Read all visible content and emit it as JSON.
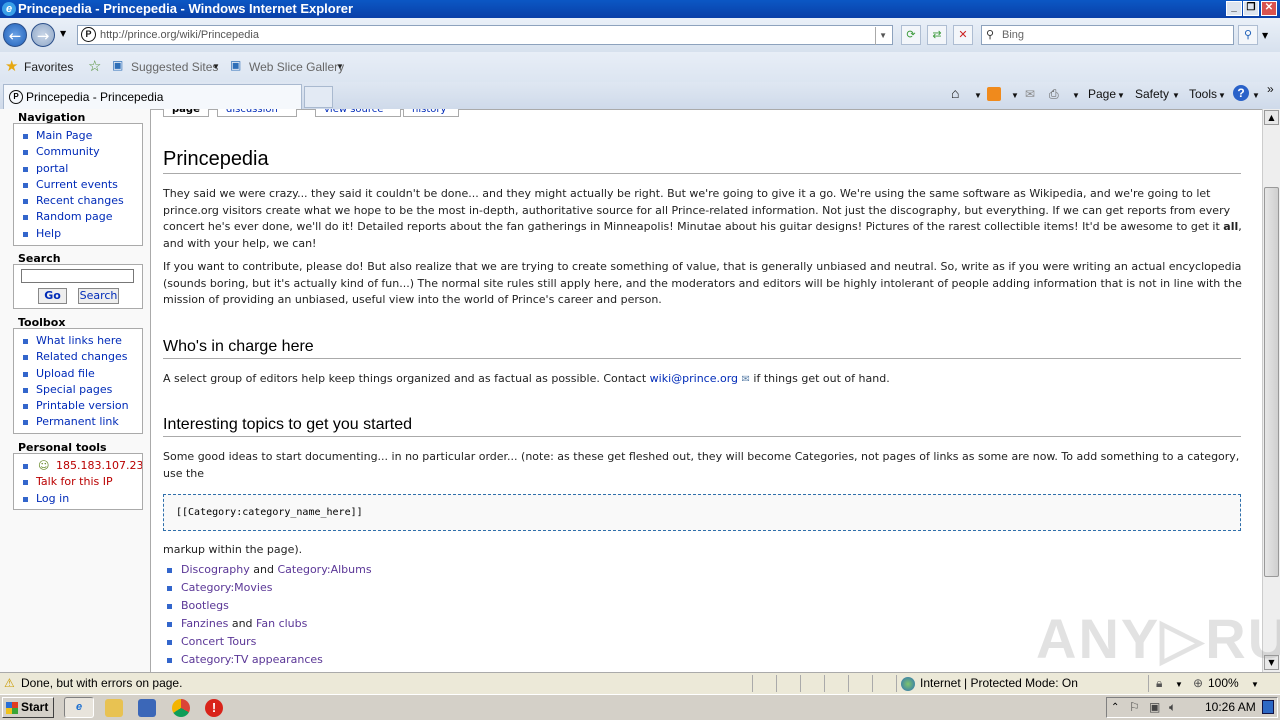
{
  "window": {
    "title": "Princepedia - Princepedia - Windows Internet Explorer"
  },
  "address": {
    "url": "http://prince.org/wiki/Princepedia",
    "search_placeholder": "Bing"
  },
  "favorites": {
    "favorites_label": "Favorites",
    "suggested_label": "Suggested Sites",
    "gallery_label": "Web Slice Gallery"
  },
  "tab": {
    "label": "Princepedia - Princepedia"
  },
  "commandbar": {
    "page": "Page",
    "safety": "Safety",
    "tools": "Tools"
  },
  "wiki_tabs": [
    "page",
    "discussion",
    "view source",
    "history"
  ],
  "sidebar": {
    "navigation_title": "Navigation",
    "navigation": [
      "Main Page",
      "Community",
      "portal",
      "Current events",
      "Recent changes",
      "Random page",
      "Help"
    ],
    "search_title": "Search",
    "go_label": "Go",
    "search_label": "Search",
    "toolbox_title": "Toolbox",
    "toolbox": [
      "What links here",
      "Related changes",
      "Upload file",
      "Special pages",
      "Printable version",
      "Permanent link"
    ],
    "personal_title": "Personal tools",
    "personal": [
      "185.183.107.23",
      "Talk for this IP",
      "Log in"
    ]
  },
  "article": {
    "title": "Princepedia",
    "intro_before_bold": "They said we were crazy... they said it couldn't be done... and they might actually be right. But we're going to give it a go. We're using the same software as Wikipedia, and we're going to let prince.org visitors create what we hope to be the most in-depth, authoritative source for all Prince-related information. Not just the discography, but everything. If we can get reports from every concert he's ever done, we'll do it! Detailed reports about the fan gatherings in Minneapolis! Minutae about his guitar designs! Pictures of the rarest collectible items! It'd be awesome to get it ",
    "intro_bold": "all",
    "intro_after_bold": ", and with your help, we can!",
    "contribute": "If you want to contribute, please do! But also realize that we are trying to create something of value, that is generally unbiased and neutral. So, write as if you were writing an actual encyclopedia (sounds boring, but it's actually kind of fun...) The normal site rules still apply here, and the moderators and editors will be highly intolerant of people adding information that is not in line with the mission of providing an unbiased, useful view into the world of Prince's career and person.",
    "charge_heading": "Who's in charge here",
    "charge_before": "A select group of editors help keep things organized and as factual as possible. Contact ",
    "charge_email": "wiki@prince.org",
    "charge_after": " if things get out of hand.",
    "topics_heading": "Interesting topics to get you started",
    "topics_intro": "Some good ideas to start documenting... in no particular order... (note: as these get fleshed out, they will become Categories, not pages of links as some are now. To add something to a category, use the",
    "code": "[[Category:category_name_here]]",
    "markup_note": "markup within the page).",
    "topics": [
      {
        "a": "Discography",
        "mid": " and ",
        "b": "Category:Albums"
      },
      {
        "a": "Category:Movies",
        "mid": "",
        "b": ""
      },
      {
        "a": "Bootlegs",
        "mid": "",
        "b": ""
      },
      {
        "a": "Fanzines",
        "mid": " and ",
        "b": "Fan clubs"
      },
      {
        "a": "Concert Tours",
        "mid": "",
        "b": ""
      },
      {
        "a": "Category:TV appearances",
        "mid": "",
        "b": ""
      }
    ]
  },
  "status": {
    "text": "Done, but with errors on page.",
    "zone": "Internet | Protected Mode: On",
    "zoom": "100%"
  },
  "taskbar": {
    "start": "Start",
    "clock": "10:26 AM"
  },
  "watermark": "ANY.RUN"
}
